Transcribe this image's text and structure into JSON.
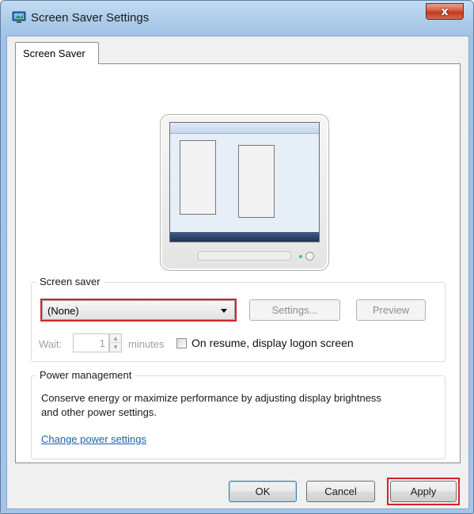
{
  "window": {
    "title": "Screen Saver Settings",
    "close_glyph": "x"
  },
  "tabs": [
    {
      "label": "Screen Saver"
    }
  ],
  "screen_saver": {
    "group_label": "Screen saver",
    "selected": "(None)",
    "settings_label": "Settings...",
    "preview_label": "Preview",
    "wait_label": "Wait:",
    "wait_value": "1",
    "minutes_label": "minutes",
    "resume_label": "On resume, display logon screen",
    "resume_checked": false
  },
  "power": {
    "group_label": "Power management",
    "description": "Conserve energy or maximize performance by adjusting display brightness and other power settings.",
    "link_label": "Change power settings"
  },
  "buttons": {
    "ok": "OK",
    "cancel": "Cancel",
    "apply": "Apply"
  },
  "colors": {
    "highlight": "#d4232e",
    "link": "#1b63a8"
  },
  "icons": {
    "title": "monitor-icon",
    "close": "close-icon",
    "dropdown": "chevron-down-icon",
    "spin_up": "arrow-up-icon",
    "spin_down": "arrow-down-icon"
  }
}
